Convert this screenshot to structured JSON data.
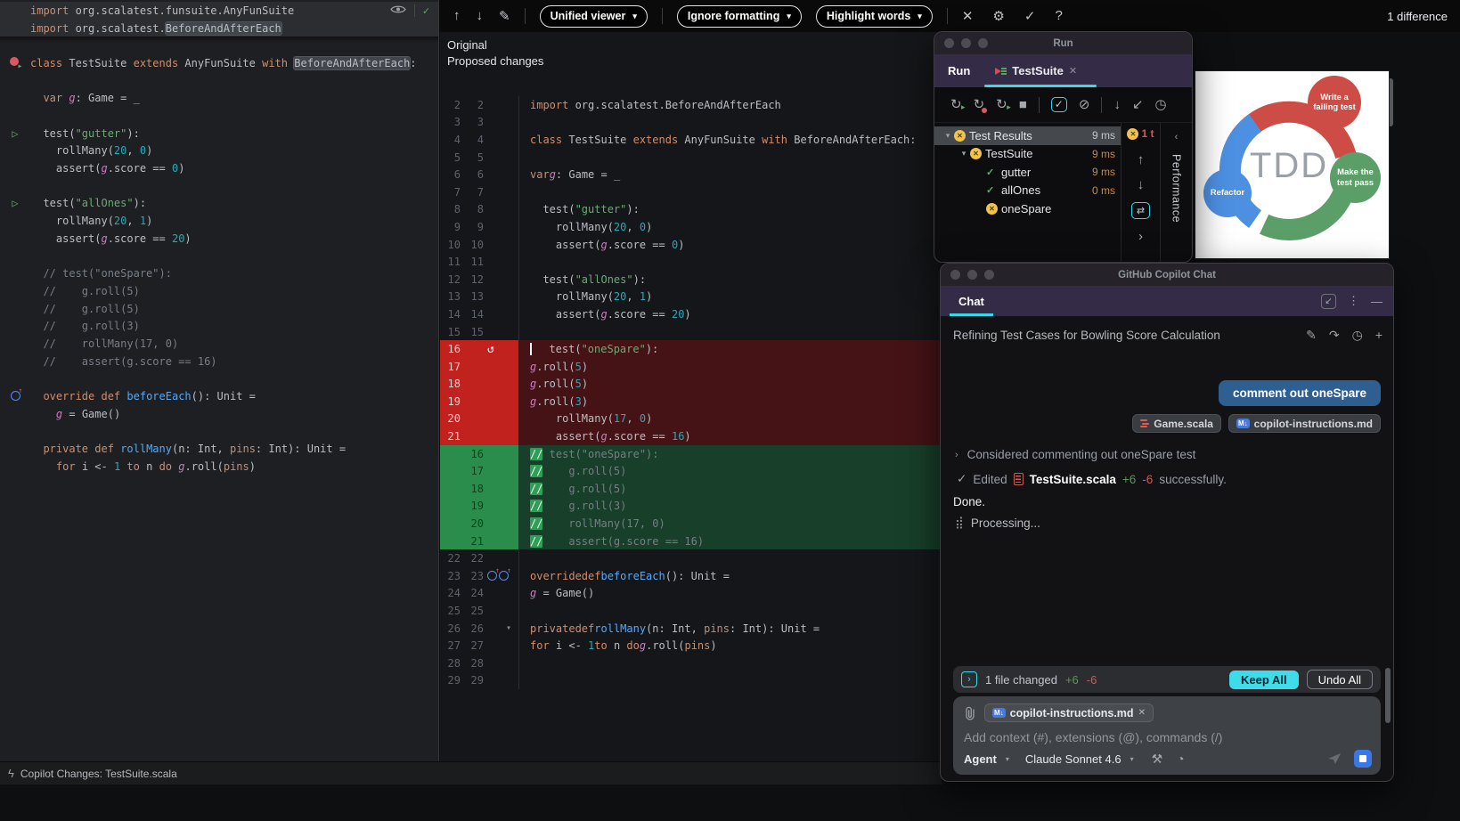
{
  "top_bar": {
    "difference_count": "1 difference",
    "nav_icons": [
      {
        "name": "prev-change-icon",
        "glyph": "↑"
      },
      {
        "name": "next-change-icon",
        "glyph": "↓"
      },
      {
        "name": "edit-icon",
        "glyph": "✎"
      }
    ],
    "dropdowns": [
      {
        "name": "viewer-select",
        "label": "Unified viewer"
      },
      {
        "name": "formatting-select",
        "label": "Ignore formatting"
      },
      {
        "name": "highlight-select",
        "label": "Highlight words"
      }
    ],
    "right_icons": [
      {
        "name": "collapse-icon",
        "glyph": "✕"
      },
      {
        "name": "settings-icon",
        "glyph": "⚙"
      },
      {
        "name": "apply-icon",
        "glyph": "✓"
      },
      {
        "name": "help-icon",
        "glyph": "?"
      }
    ]
  },
  "diff": {
    "label_original": "Original",
    "label_proposed": "Proposed changes",
    "rows": [
      {
        "n1": "2",
        "n2": "2",
        "type": "ctx",
        "text": "import org.scalatest.BeforeAndAfterEach"
      },
      {
        "n1": "3",
        "n2": "3",
        "type": "ctx",
        "text": ""
      },
      {
        "n1": "4",
        "n2": "4",
        "type": "ctx",
        "text": "class TestSuite extends AnyFunSuite with BeforeAndAfterEach:"
      },
      {
        "n1": "5",
        "n2": "5",
        "type": "ctx",
        "text": ""
      },
      {
        "n1": "6",
        "n2": "6",
        "type": "ctx",
        "text": "  var g: Game = _"
      },
      {
        "n1": "7",
        "n2": "7",
        "type": "ctx",
        "text": ""
      },
      {
        "n1": "8",
        "n2": "8",
        "type": "ctx",
        "text": "  test(\"gutter\"):"
      },
      {
        "n1": "9",
        "n2": "9",
        "type": "ctx",
        "text": "    rollMany(20, 0)"
      },
      {
        "n1": "10",
        "n2": "10",
        "type": "ctx",
        "text": "    assert(g.score == 0)"
      },
      {
        "n1": "11",
        "n2": "11",
        "type": "ctx",
        "text": ""
      },
      {
        "n1": "12",
        "n2": "12",
        "type": "ctx",
        "text": "  test(\"allOnes\"):"
      },
      {
        "n1": "13",
        "n2": "13",
        "type": "ctx",
        "text": "    rollMany(20, 1)"
      },
      {
        "n1": "14",
        "n2": "14",
        "type": "ctx",
        "text": "    assert(g.score == 20)"
      },
      {
        "n1": "15",
        "n2": "15",
        "type": "ctx",
        "text": ""
      },
      {
        "n1": "16",
        "n2": "",
        "type": "del",
        "text": "  test(\"oneSpare\"):",
        "icons": [
          "undo",
          "caret"
        ]
      },
      {
        "n1": "17",
        "n2": "",
        "type": "del",
        "text": "    g.roll(5)"
      },
      {
        "n1": "18",
        "n2": "",
        "type": "del",
        "text": "    g.roll(5)"
      },
      {
        "n1": "19",
        "n2": "",
        "type": "del",
        "text": "    g.roll(3)"
      },
      {
        "n1": "20",
        "n2": "",
        "type": "del",
        "text": "    rollMany(17, 0)"
      },
      {
        "n1": "21",
        "n2": "",
        "type": "del",
        "text": "    assert(g.score == 16)"
      },
      {
        "n1": "",
        "n2": "16",
        "type": "add",
        "text": "  // test(\"oneSpare\"):"
      },
      {
        "n1": "",
        "n2": "17",
        "type": "add",
        "text": "  //    g.roll(5)"
      },
      {
        "n1": "",
        "n2": "18",
        "type": "add",
        "text": "  //    g.roll(5)"
      },
      {
        "n1": "",
        "n2": "19",
        "type": "add",
        "text": "  //    g.roll(3)"
      },
      {
        "n1": "",
        "n2": "20",
        "type": "add",
        "text": "  //    rollMany(17, 0)"
      },
      {
        "n1": "",
        "n2": "21",
        "type": "add",
        "text": "  //    assert(g.score == 16)"
      },
      {
        "n1": "22",
        "n2": "22",
        "type": "ctx",
        "text": ""
      },
      {
        "n1": "23",
        "n2": "23",
        "type": "ctx",
        "text": "  override def beforeEach(): Unit =",
        "icons": [
          "override",
          "override"
        ]
      },
      {
        "n1": "24",
        "n2": "24",
        "type": "ctx",
        "text": "    g = Game()"
      },
      {
        "n1": "25",
        "n2": "25",
        "type": "ctx",
        "text": ""
      },
      {
        "n1": "26",
        "n2": "26",
        "type": "ctx",
        "text": "  private def rollMany(n: Int, pins: Int): Unit =",
        "icons": [
          "collapse"
        ]
      },
      {
        "n1": "27",
        "n2": "27",
        "type": "ctx",
        "text": "    for i <- 1 to n do g.roll(pins)"
      },
      {
        "n1": "28",
        "n2": "28",
        "type": "ctx",
        "text": ""
      },
      {
        "n1": "29",
        "n2": "29",
        "type": "ctx",
        "text": ""
      }
    ]
  },
  "left_editor": {
    "lines": [
      {
        "text": "import org.scalatest.funsuite.AnyFunSuite",
        "bg": "pin",
        "right": true
      },
      {
        "text": "import org.scalatest.BeforeAndAfterEach",
        "bg": "pin",
        "sel": "BeforeAndAfterEach"
      },
      {
        "text": ""
      },
      {
        "text": "class TestSuite extends AnyFunSuite with BeforeAndAfterEach:",
        "icon": "runclass",
        "sel": "BeforeAndAfterEach"
      },
      {
        "text": ""
      },
      {
        "text": "  var g: Game = _"
      },
      {
        "text": ""
      },
      {
        "text": "  test(\"gutter\"):",
        "icon": "play"
      },
      {
        "text": "    rollMany(20, 0)"
      },
      {
        "text": "    assert(g.score == 0)"
      },
      {
        "text": ""
      },
      {
        "text": "  test(\"allOnes\"):",
        "icon": "play"
      },
      {
        "text": "    rollMany(20, 1)"
      },
      {
        "text": "    assert(g.score == 20)"
      },
      {
        "text": ""
      },
      {
        "text": "  // test(\"oneSpare\"):"
      },
      {
        "text": "  //    g.roll(5)"
      },
      {
        "text": "  //    g.roll(5)"
      },
      {
        "text": "  //    g.roll(3)"
      },
      {
        "text": "  //    rollMany(17, 0)"
      },
      {
        "text": "  //    assert(g.score == 16)"
      },
      {
        "text": ""
      },
      {
        "text": "  override def beforeEach(): Unit =",
        "icon": "override"
      },
      {
        "text": "    g = Game()"
      },
      {
        "text": ""
      },
      {
        "text": "  private def rollMany(n: Int, pins: Int): Unit ="
      },
      {
        "text": "    for i <- 1 to n do g.roll(pins)"
      }
    ]
  },
  "status_bar": {
    "icon_glyph": "ϟ",
    "text": "Copilot Changes: TestSuite.scala"
  },
  "run_window": {
    "window_title": "Run",
    "tab_run": "Run",
    "tab_testsuite": "TestSuite",
    "toolbar": [
      {
        "name": "rerun-icon",
        "glyph": "↻",
        "overlay": "play"
      },
      {
        "name": "rerun-failed-icon",
        "glyph": "↻",
        "overlay": "dot"
      },
      {
        "name": "auto-test-icon",
        "glyph": "↻",
        "overlay": "play"
      },
      {
        "name": "stop-icon",
        "glyph": "■"
      },
      {
        "name": "sep"
      },
      {
        "name": "show-passed-icon",
        "glyph": "✓",
        "boxed": true
      },
      {
        "name": "show-ignored-icon",
        "glyph": "⊘"
      },
      {
        "name": "sep"
      },
      {
        "name": "sort-icon",
        "glyph": "↓"
      },
      {
        "name": "import-results-icon",
        "glyph": "↙"
      },
      {
        "name": "history-icon",
        "glyph": "◷"
      }
    ],
    "tree": [
      {
        "label": "Test Results",
        "time": "9 ms",
        "icon": "ignored",
        "chevron": true,
        "indent": 0,
        "selected": true,
        "muted": true
      },
      {
        "label": "TestSuite",
        "time": "9 ms",
        "icon": "ignored",
        "chevron": true,
        "indent": 1
      },
      {
        "label": "gutter",
        "time": "9 ms",
        "icon": "passed",
        "indent": 2
      },
      {
        "label": "allOnes",
        "time": "0 ms",
        "icon": "passed",
        "indent": 2
      },
      {
        "label": "oneSpare",
        "time": "",
        "icon": "ignored",
        "indent": 2
      }
    ],
    "rail": {
      "badge": "1 t",
      "icons": [
        {
          "name": "scroll-up-icon",
          "glyph": "↑"
        },
        {
          "name": "scroll-down-icon",
          "glyph": "↓"
        },
        {
          "name": "autoscroll-icon",
          "glyph": "⇄",
          "boxed": true
        },
        {
          "name": "expand-icon",
          "glyph": "›"
        }
      ],
      "collapse_glyph": "‹",
      "performance_tab": "Performance"
    }
  },
  "tdd_image": {
    "center": "TDD",
    "steps": [
      {
        "label": "Write a failing test",
        "color": "#cd4c46"
      },
      {
        "label": "Make the test pass",
        "color": "#5b9e68"
      },
      {
        "label": "Refactor",
        "color": "#4d90e2"
      }
    ]
  },
  "chat_window": {
    "window_title": "GitHub Copilot Chat",
    "tab": "Chat",
    "header_icons": [
      {
        "name": "open-in-editor-icon",
        "glyph": "↙",
        "boxed": true
      },
      {
        "name": "more-options-icon",
        "glyph": "⋮"
      },
      {
        "name": "minimize-icon",
        "glyph": "—"
      }
    ],
    "session_title": "Refining Test Cases for Bowling Score Calculation",
    "session_icons": [
      {
        "name": "rename-icon",
        "glyph": "✎"
      },
      {
        "name": "restore-icon",
        "glyph": "↷"
      },
      {
        "name": "history-icon",
        "glyph": "◷"
      },
      {
        "name": "new-chat-icon",
        "glyph": "+"
      }
    ],
    "user_message": "comment out oneSpare",
    "context_chips": [
      {
        "icon": "scala",
        "label": "Game.scala"
      },
      {
        "icon": "markdown",
        "label": "copilot-instructions.md"
      }
    ],
    "thought": "Considered commenting out oneSpare test",
    "edited": {
      "verb": "Edited",
      "file": "TestSuite.scala",
      "added": "+6",
      "removed": "-6",
      "suffix": "successfully."
    },
    "done": "Done.",
    "processing": "Processing...",
    "spinner_glyph": "⣾",
    "files_bar": {
      "label": "1 file changed",
      "added": "+6",
      "removed": "-6",
      "keep": "Keep All",
      "undo": "Undo All"
    },
    "attachment": {
      "label": "copilot-instructions.md"
    },
    "input_placeholder": "Add context (#), extensions (@), commands (/)",
    "footer": {
      "mode": "Agent",
      "model": "Claude Sonnet 4.6"
    },
    "accent_cyan": "#38d8e6",
    "bubble_blue": "#2f5f90"
  }
}
